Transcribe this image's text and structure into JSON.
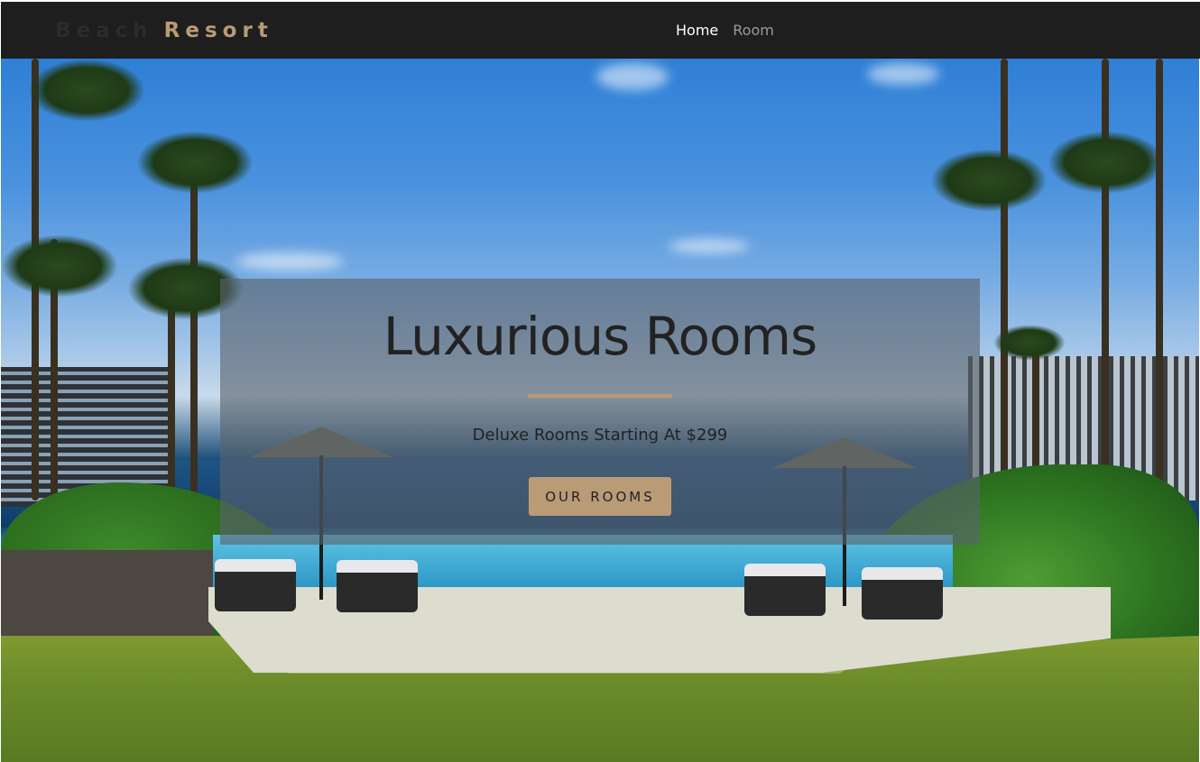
{
  "brand": {
    "prefix": "Beach",
    "name": "Resort",
    "accent_color": "#b99b76"
  },
  "nav": {
    "items": [
      {
        "label": "Home",
        "active": true
      },
      {
        "label": "Room",
        "active": false
      }
    ],
    "background_color": "#1e1e1e"
  },
  "hero": {
    "title": "Luxurious Rooms",
    "subtitle": "Deluxe Rooms Starting At $299",
    "button_label": "OUR ROOMS"
  }
}
